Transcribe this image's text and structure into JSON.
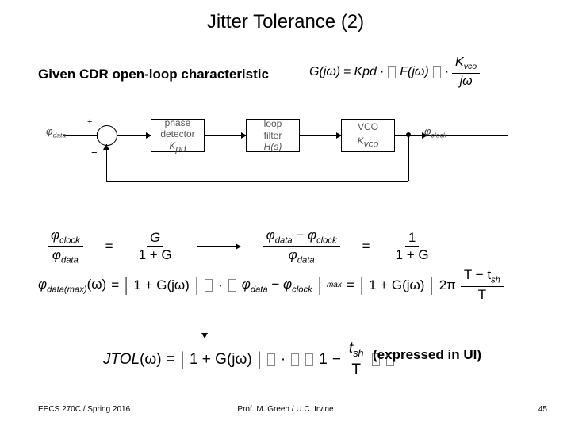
{
  "title": "Jitter Tolerance (2)",
  "given": "Given CDR open-loop characteristic",
  "open_eq": {
    "lhs": "G(jω)",
    "eq": "=",
    "kpd": "Kpd",
    "dot1": "·",
    "F": "F(jω)",
    "dot2": "·",
    "kvco": "K",
    "kvco_sub": "vco",
    "jw": "jω"
  },
  "diagram": {
    "phi_data_in": "φ",
    "phi_data_in_sub": "data",
    "phi_clock_out": "φ",
    "phi_clock_out_sub": "clock",
    "pd_line1": "phase",
    "pd_line2": "detector",
    "pd_sub": "K",
    "pd_sub2": "pd",
    "lf_line1": "loop",
    "lf_line2": "filter",
    "lf_sub": "H(s)",
    "vco_line1": "VCO",
    "vco_sub": "K",
    "vco_sub2": "vco"
  },
  "eq1": {
    "num_a": "φ",
    "num_a_sub": "clock",
    "den_a": "φ",
    "den_a_sub": "data",
    "eq": "=",
    "num_b": "G",
    "den_b": "1 + G"
  },
  "eq2": {
    "nA": "φ",
    "nA_sub": "data",
    "minus": " − ",
    "nB": "φ",
    "nB_sub": "clock",
    "den": "φ",
    "den_sub": "data",
    "eq": "=",
    "one": "1",
    "den2": "1 + G"
  },
  "phimax": {
    "lhs_a": "φ",
    "lhs_sub": "data(max)",
    "lhs_w": "(ω)",
    "eq": "=",
    "G": "1 + G(jω)",
    "dot": "·",
    "inner_a": "φ",
    "inner_a_sub": "data",
    "minus": " − ",
    "inner_b": "φ",
    "inner_b_sub": "clock",
    "max": "max",
    "eq2": "=",
    "two_pi": "2π",
    "Tnum_a": "T − t",
    "Tnum_sub": "sh",
    "Tden": "T"
  },
  "jtol": {
    "name": "JTOL",
    "w": "(ω)",
    "eq": "=",
    "G": "1 + G(jω)",
    "dot": "·",
    "one": "1",
    "minus": " − ",
    "tsh": "t",
    "tsh_sub": "sh",
    "T": "T"
  },
  "expressed": "(expressed in UI)",
  "footer": {
    "left": "EECS 270C / Spring 2016",
    "mid": "Prof. M. Green / U.C. Irvine",
    "right": "45"
  }
}
